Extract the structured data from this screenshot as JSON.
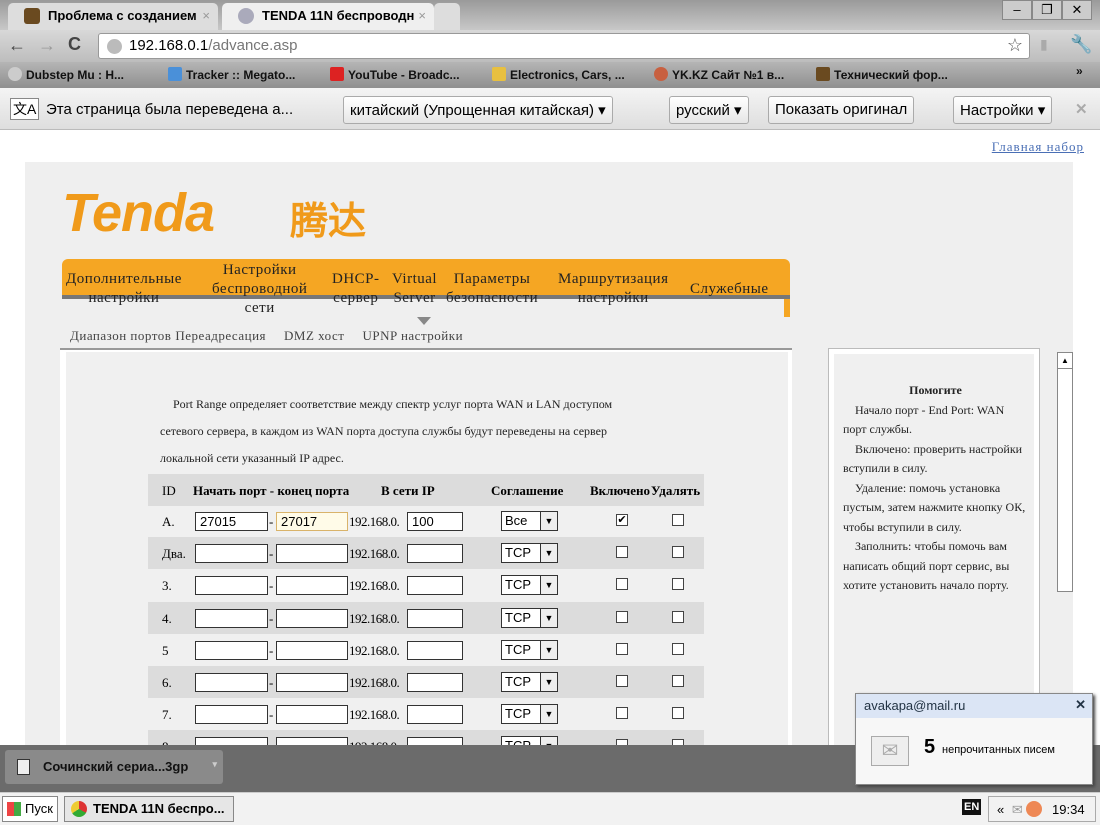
{
  "browser": {
    "tabs": [
      {
        "title": "Проблема с созданием"
      },
      {
        "title": "TENDA 11N беспроводн"
      }
    ],
    "url_host": "192.168.0.1",
    "url_path": "/advance.asp",
    "bookmarks": [
      "Dubstep Mu : H...",
      "Tracker :: Megato...",
      "YouTube - Broadc...",
      "Electronics, Cars, ...",
      "YK.KZ Сайт №1 в...",
      "Технический фор..."
    ],
    "bookmarks_more": "»",
    "translate": {
      "message": "Эта страница была переведена а...",
      "from": "китайский (Упрощенная китайская)",
      "to": "русский",
      "show_original": "Показать оригинал",
      "settings": "Настройки"
    }
  },
  "page": {
    "home_link": "Главная набор",
    "logo": "Tenda",
    "logo_cn": "腾达",
    "nav": [
      [
        "Дополнительные",
        "настройки"
      ],
      [
        "Настройки",
        "беспроводной",
        "сети"
      ],
      [
        "DHCP-",
        "сервер"
      ],
      [
        "Virtual",
        "Server"
      ],
      [
        "Параметры",
        "безопасности"
      ],
      [
        "Маршрутизация",
        "настройки"
      ],
      [
        "Служебные"
      ]
    ],
    "subnav": [
      "Диапазон портов",
      "Переадресация",
      "DMZ хост",
      "UPNP настройки"
    ],
    "intro": [
      "Port Range определяет соответствие между спектр услуг порта WAN и LAN доступом",
      "сетевого сервера, в каждом из WAN порта доступа службы будут переведены на сервер",
      "локальной сети указанный IP адрес."
    ],
    "table": {
      "headers": [
        "ID",
        "Начать порт - конец порта",
        "В сети IP",
        "Соглашение",
        "Включено",
        "Удалять"
      ],
      "ip_prefix": "192.168.0.",
      "rows": [
        {
          "id": "A.",
          "start": "27015",
          "end": "27017",
          "ip": "100",
          "proto": "Все",
          "enabled": true,
          "delete": false
        },
        {
          "id": "Два.",
          "start": "",
          "end": "",
          "ip": "",
          "proto": "TCP",
          "enabled": false,
          "delete": false
        },
        {
          "id": "3.",
          "start": "",
          "end": "",
          "ip": "",
          "proto": "TCP",
          "enabled": false,
          "delete": false
        },
        {
          "id": "4.",
          "start": "",
          "end": "",
          "ip": "",
          "proto": "TCP",
          "enabled": false,
          "delete": false
        },
        {
          "id": "5",
          "start": "",
          "end": "",
          "ip": "",
          "proto": "TCP",
          "enabled": false,
          "delete": false
        },
        {
          "id": "6.",
          "start": "",
          "end": "",
          "ip": "",
          "proto": "TCP",
          "enabled": false,
          "delete": false
        },
        {
          "id": "7.",
          "start": "",
          "end": "",
          "ip": "",
          "proto": "TCP",
          "enabled": false,
          "delete": false
        },
        {
          "id": "8.",
          "start": "",
          "end": "",
          "ip": "",
          "proto": "TCP",
          "enabled": false,
          "delete": false
        }
      ]
    },
    "help": {
      "title": "Помогите",
      "lines": [
        "Начало порт - End Port: WAN порт службы.",
        "Включено: проверить настройки вступили в силу.",
        "Удаление: помочь установка пустым, затем нажмите кнопку ОК, чтобы вступили в силу.",
        "Заполнить: чтобы помочь вам написать общий порт сервис, вы хотите установить начало порту."
      ]
    }
  },
  "download": {
    "name": "Сочинский сериа...3gp"
  },
  "mail_popup": {
    "account": "avakapa@mail.ru",
    "count": "5",
    "text": "непрочитанных писем"
  },
  "taskbar": {
    "start": "Пуск",
    "task": "TENDA 11N беспро...",
    "lang": "EN",
    "chevron": "«",
    "time": "19:34"
  }
}
